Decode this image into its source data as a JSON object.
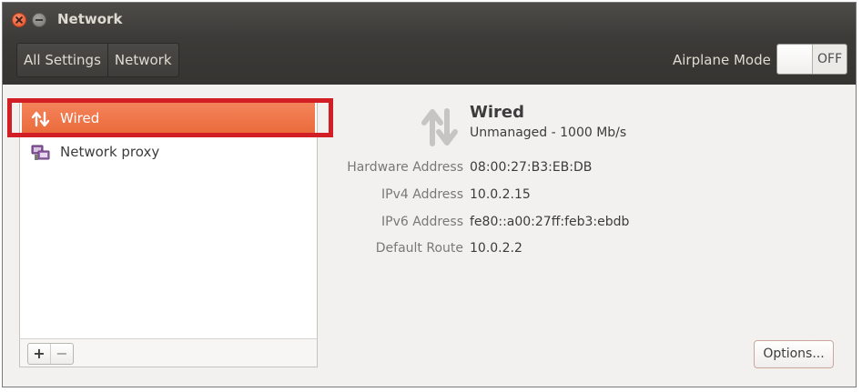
{
  "window": {
    "title": "Network"
  },
  "toolbar": {
    "breadcrumbs": [
      "All Settings",
      "Network"
    ],
    "airplane_label": "Airplane Mode",
    "airplane_toggle": "OFF"
  },
  "sidebar": {
    "items": [
      {
        "label": "Wired",
        "icon": "wired-arrows-icon",
        "selected": true
      },
      {
        "label": "Network proxy",
        "icon": "network-proxy-icon",
        "selected": false
      }
    ],
    "add_label": "+",
    "remove_label": "−"
  },
  "detail": {
    "title": "Wired",
    "subtitle": "Unmanaged - 1000 Mb/s",
    "properties": [
      {
        "label": "Hardware Address",
        "value": "08:00:27:B3:EB:DB"
      },
      {
        "label": "IPv4 Address",
        "value": "10.0.2.15"
      },
      {
        "label": "IPv6 Address",
        "value": "fe80::a00:27ff:feb3:ebdb"
      },
      {
        "label": "Default Route",
        "value": "10.0.2.2"
      }
    ],
    "options_label": "Options..."
  },
  "colors": {
    "selection": "#ea6b3b",
    "highlight_box": "#d21f26",
    "titlebar": "#3d3b38"
  }
}
